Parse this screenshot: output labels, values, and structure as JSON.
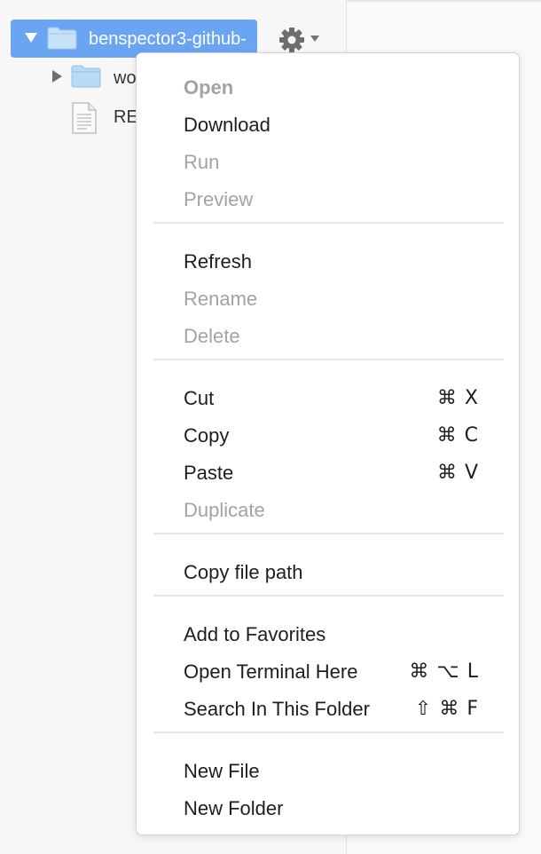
{
  "tree": {
    "root": {
      "label": "benspector3-github-"
    },
    "children": [
      {
        "label": "wo",
        "type": "folder"
      },
      {
        "label": "RE",
        "type": "file"
      }
    ],
    "settings": {
      "icon": "gear-icon"
    }
  },
  "menu": {
    "groups": [
      [
        {
          "label": "Open",
          "shortcut": "",
          "enabled": false,
          "bold": true
        },
        {
          "label": "Download",
          "shortcut": "",
          "enabled": true
        },
        {
          "label": "Run",
          "shortcut": "",
          "enabled": false
        },
        {
          "label": "Preview",
          "shortcut": "",
          "enabled": false
        }
      ],
      [
        {
          "label": "Refresh",
          "shortcut": "",
          "enabled": true
        },
        {
          "label": "Rename",
          "shortcut": "",
          "enabled": false
        },
        {
          "label": "Delete",
          "shortcut": "",
          "enabled": false
        }
      ],
      [
        {
          "label": "Cut",
          "shortcut": "⌘ X",
          "enabled": true
        },
        {
          "label": "Copy",
          "shortcut": "⌘ C",
          "enabled": true
        },
        {
          "label": "Paste",
          "shortcut": "⌘ V",
          "enabled": true
        },
        {
          "label": "Duplicate",
          "shortcut": "",
          "enabled": false
        }
      ],
      [
        {
          "label": "Copy file path",
          "shortcut": "",
          "enabled": true
        }
      ],
      [
        {
          "label": "Add to Favorites",
          "shortcut": "",
          "enabled": true
        },
        {
          "label": "Open Terminal Here",
          "shortcut": "⌘ ⌥ L",
          "enabled": true
        },
        {
          "label": "Search In This Folder",
          "shortcut": "⇧ ⌘ F",
          "enabled": true
        }
      ],
      [
        {
          "label": "New File",
          "shortcut": "",
          "enabled": true
        },
        {
          "label": "New Folder",
          "shortcut": "",
          "enabled": true
        }
      ]
    ]
  },
  "colors": {
    "selection": "#6aa5f4",
    "folder_fill": "#b9dcf6",
    "disabled_text": "#a3a3a3"
  }
}
